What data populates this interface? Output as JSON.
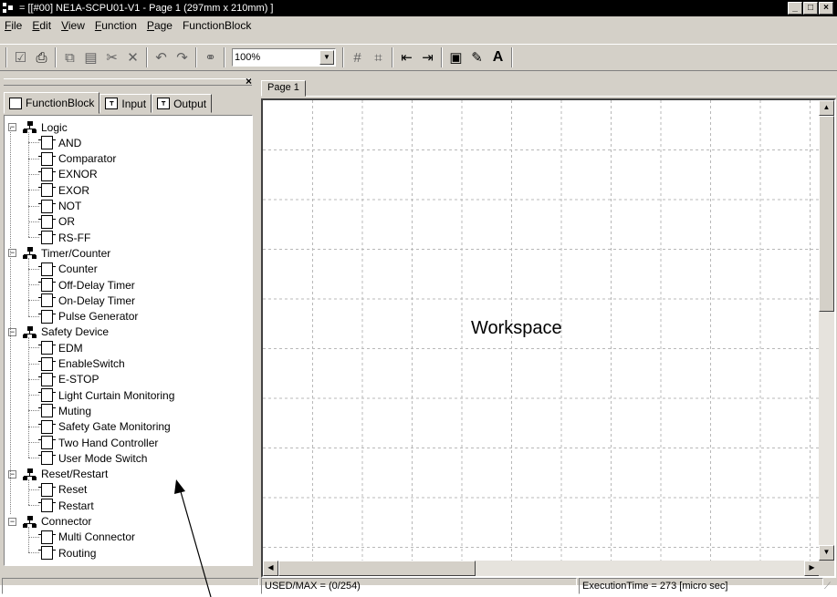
{
  "window": {
    "title": "= [[#00] NE1A-SCPU01-V1 - Page 1 (297mm x 210mm) ]",
    "controls": [
      "_",
      "□",
      "×"
    ]
  },
  "menu": [
    {
      "underline": "F",
      "rest": "ile"
    },
    {
      "underline": "E",
      "rest": "dit"
    },
    {
      "underline": "V",
      "rest": "iew"
    },
    {
      "underline": "F",
      "rest": "unction"
    },
    {
      "underline": "P",
      "rest": "age"
    },
    {
      "underline": "",
      "rest": "FunctionBlock"
    }
  ],
  "toolbar": {
    "zoom_value": "100%",
    "text_tool": "A"
  },
  "left_pane": {
    "close_glyph": "×",
    "tabs": [
      "FunctionBlock",
      "Input",
      "Output"
    ],
    "active_tab": "FunctionBlock"
  },
  "tree": [
    {
      "label": "Logic",
      "expanded": true,
      "children": [
        "AND",
        "Comparator",
        "EXNOR",
        "EXOR",
        "NOT",
        "OR",
        "RS-FF"
      ]
    },
    {
      "label": "Timer/Counter",
      "expanded": true,
      "children": [
        "Counter",
        "Off-Delay Timer",
        "On-Delay Timer",
        "Pulse Generator"
      ]
    },
    {
      "label": "Safety Device",
      "expanded": true,
      "children": [
        "EDM",
        "EnableSwitch",
        "E-STOP",
        "Light Curtain Monitoring",
        "Muting",
        "Safety Gate Monitoring",
        "Two Hand Controller",
        "User Mode Switch"
      ]
    },
    {
      "label": "Reset/Restart",
      "expanded": true,
      "children": [
        "Reset",
        "Restart"
      ]
    },
    {
      "label": "Connector",
      "expanded": true,
      "children": [
        "Multi Connector",
        "Routing"
      ]
    }
  ],
  "workspace": {
    "page_tab": "Page 1",
    "label": "Workspace"
  },
  "status": {
    "used_max": "USED/MAX = (0/254)",
    "execution_time": "ExecutionTime = 273 [micro sec]"
  }
}
